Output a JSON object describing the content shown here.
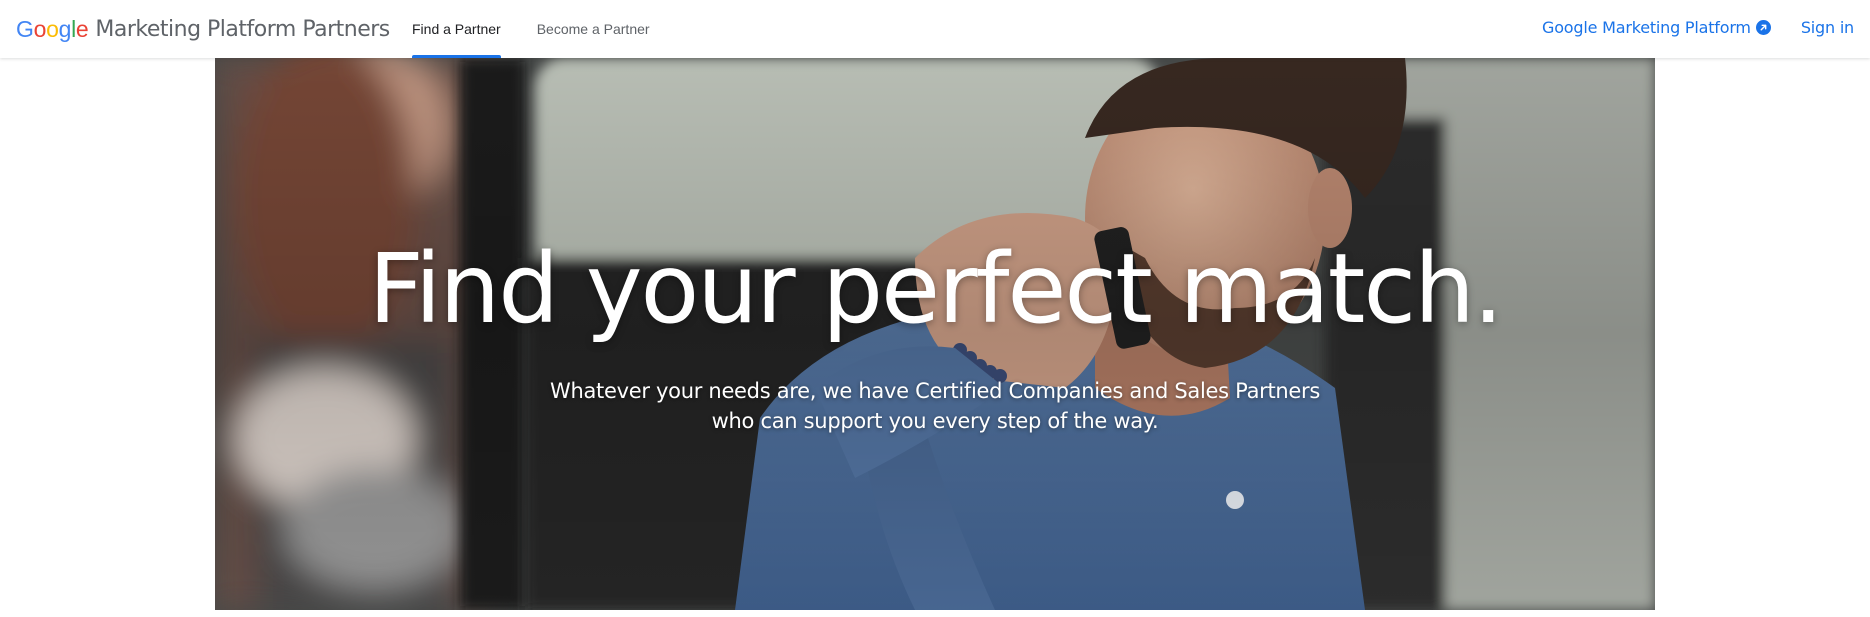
{
  "header": {
    "logo_letters": [
      {
        "char": "G",
        "color": "#4285F4"
      },
      {
        "char": "o",
        "color": "#EA4335"
      },
      {
        "char": "o",
        "color": "#FBBC05"
      },
      {
        "char": "g",
        "color": "#4285F4"
      },
      {
        "char": "l",
        "color": "#34A853"
      },
      {
        "char": "e",
        "color": "#EA4335"
      }
    ],
    "brand_title": "Marketing Platform Partners",
    "nav": [
      {
        "label": "Find a Partner",
        "active": true
      },
      {
        "label": "Become a Partner",
        "active": false
      }
    ],
    "gmp_link": "Google Marketing Platform",
    "gmp_icon": "external-link-icon",
    "sign_in": "Sign in",
    "accent_color": "#1a73e8"
  },
  "hero": {
    "title": "Find your perfect match.",
    "subtitle_line1": "Whatever your needs are, we have Certified Companies and Sales Partners",
    "subtitle_line2": "who can support you every step of the way."
  }
}
